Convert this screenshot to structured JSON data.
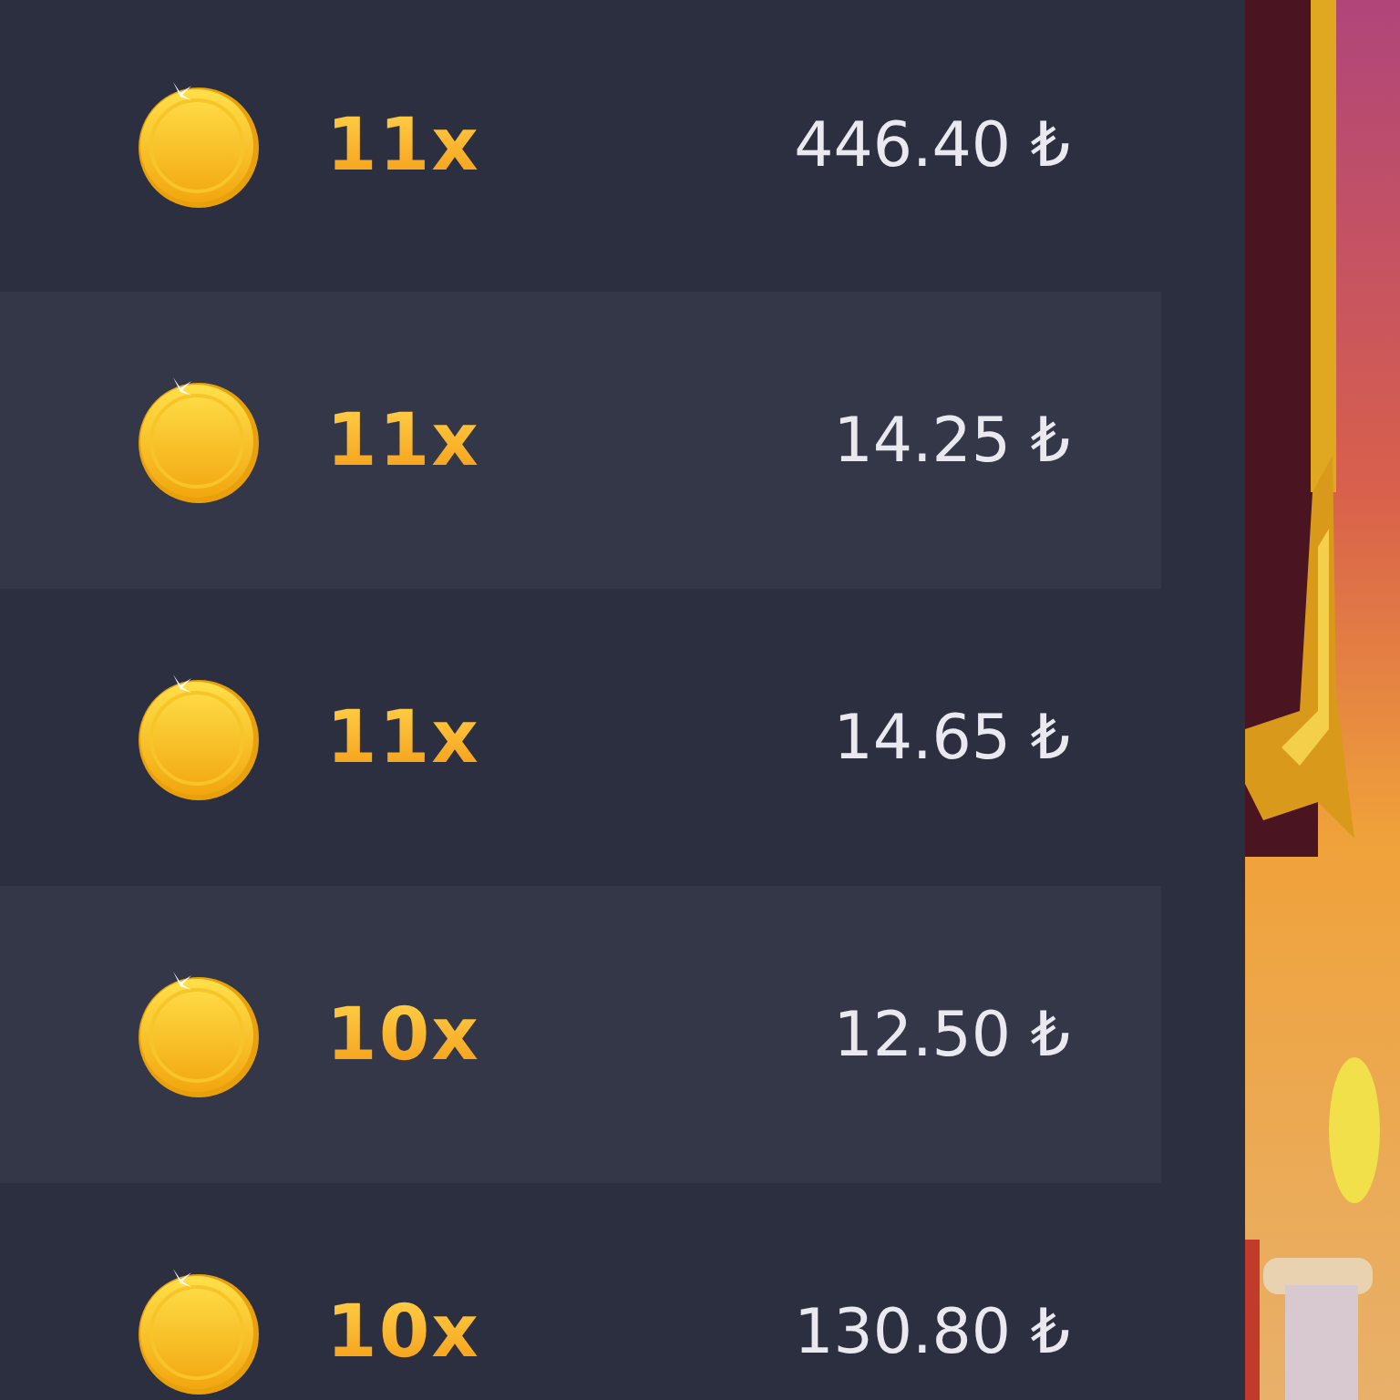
{
  "rows": [
    {
      "multiplier": "11x",
      "amount": "446.40 ₺"
    },
    {
      "multiplier": "11x",
      "amount": "14.25 ₺"
    },
    {
      "multiplier": "11x",
      "amount": "14.65 ₺"
    },
    {
      "multiplier": "10x",
      "amount": "12.50 ₺"
    },
    {
      "multiplier": "10x",
      "amount": "130.80 ₺"
    }
  ]
}
